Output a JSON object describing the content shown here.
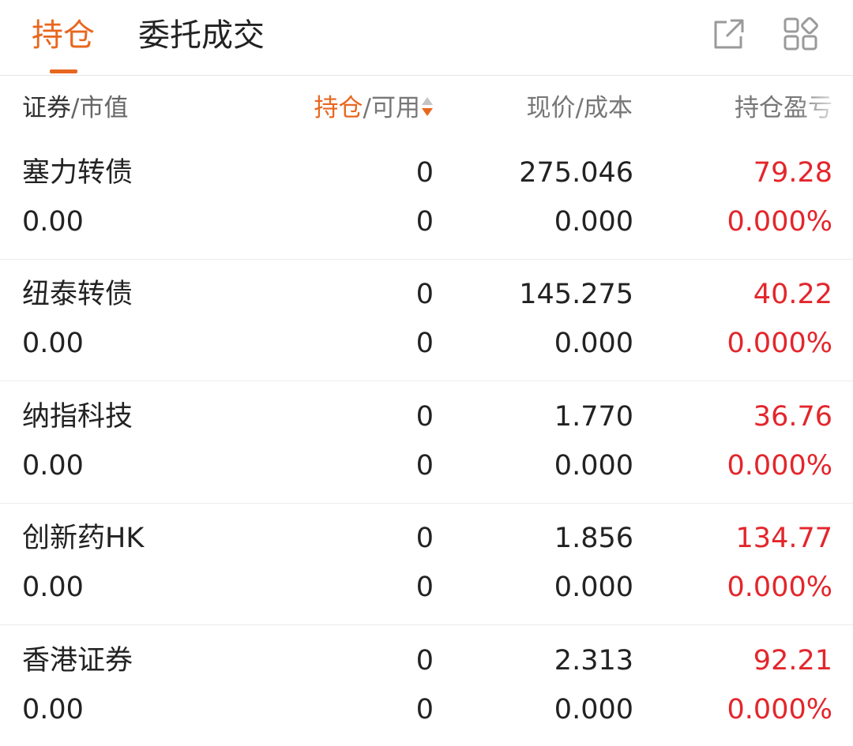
{
  "tabs": [
    {
      "label": "持仓",
      "active": true
    },
    {
      "label": "委托成交",
      "active": false
    }
  ],
  "toolbar": {
    "export_icon": "external-link-icon",
    "grid_icon": "grid-icon"
  },
  "columns": {
    "security_main": "证券",
    "security_sub": "/市值",
    "position_main": "持仓",
    "position_sub": "/可用",
    "price": "现价/成本",
    "pnl": "持仓盈亏"
  },
  "colors": {
    "accent": "#e8671f",
    "loss_profit": "#e3262c"
  },
  "rows": [
    {
      "name": "塞力转债",
      "market_value": "0.00",
      "position": "0",
      "available": "0",
      "price": "275.046",
      "cost": "0.000",
      "pnl": "79.28",
      "pnl_pct": "0.000%"
    },
    {
      "name": "纽泰转债",
      "market_value": "0.00",
      "position": "0",
      "available": "0",
      "price": "145.275",
      "cost": "0.000",
      "pnl": "40.22",
      "pnl_pct": "0.000%"
    },
    {
      "name": "纳指科技",
      "market_value": "0.00",
      "position": "0",
      "available": "0",
      "price": "1.770",
      "cost": "0.000",
      "pnl": "36.76",
      "pnl_pct": "0.000%"
    },
    {
      "name": "创新药HK",
      "market_value": "0.00",
      "position": "0",
      "available": "0",
      "price": "1.856",
      "cost": "0.000",
      "pnl": "134.77",
      "pnl_pct": "0.000%"
    },
    {
      "name": "香港证券",
      "market_value": "0.00",
      "position": "0",
      "available": "0",
      "price": "2.313",
      "cost": "0.000",
      "pnl": "92.21",
      "pnl_pct": "0.000%"
    }
  ]
}
